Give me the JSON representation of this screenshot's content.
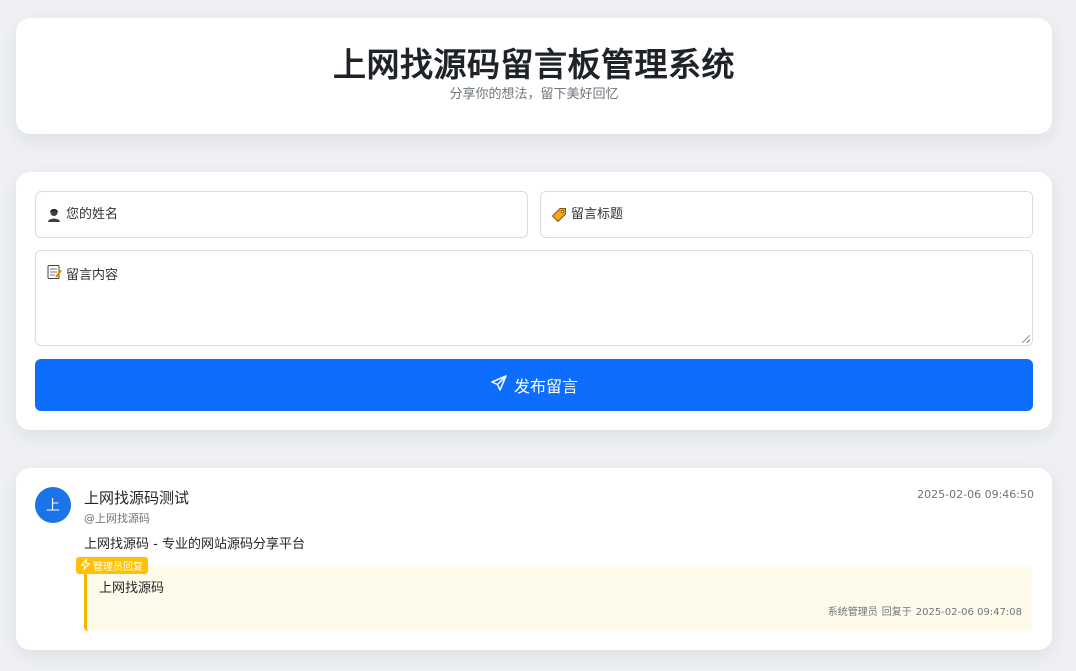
{
  "header": {
    "title": "上网找源码留言板管理系统",
    "subtitle": "分享你的想法，留下美好回忆"
  },
  "form": {
    "name_placeholder": "您的姓名",
    "name_icon": "user-icon",
    "title_placeholder": "留言标题",
    "title_icon": "tag-icon",
    "content_placeholder": "留言内容",
    "content_icon": "memo-icon",
    "submit_label": "发布留言",
    "submit_icon": "send-icon"
  },
  "messages": [
    {
      "avatar_letter": "上",
      "title": "上网找源码测试",
      "author": "@上网找源码",
      "time": "2025-02-06 09:46:50",
      "content": "上网找源码 - 专业的网站源码分享平台",
      "reply": {
        "badge": "管理员回复",
        "content": "上网找源码",
        "replier": "系统管理员",
        "reply_prefix": "回复于",
        "reply_time": "2025-02-06 09:47:08"
      }
    }
  ],
  "colors": {
    "primary": "#0d6efd",
    "avatar": "#1a73e8",
    "reply_accent": "#f5b400",
    "reply_background": "#fffbea",
    "badge": "#ffc107",
    "page_background": "#eef0f3"
  }
}
